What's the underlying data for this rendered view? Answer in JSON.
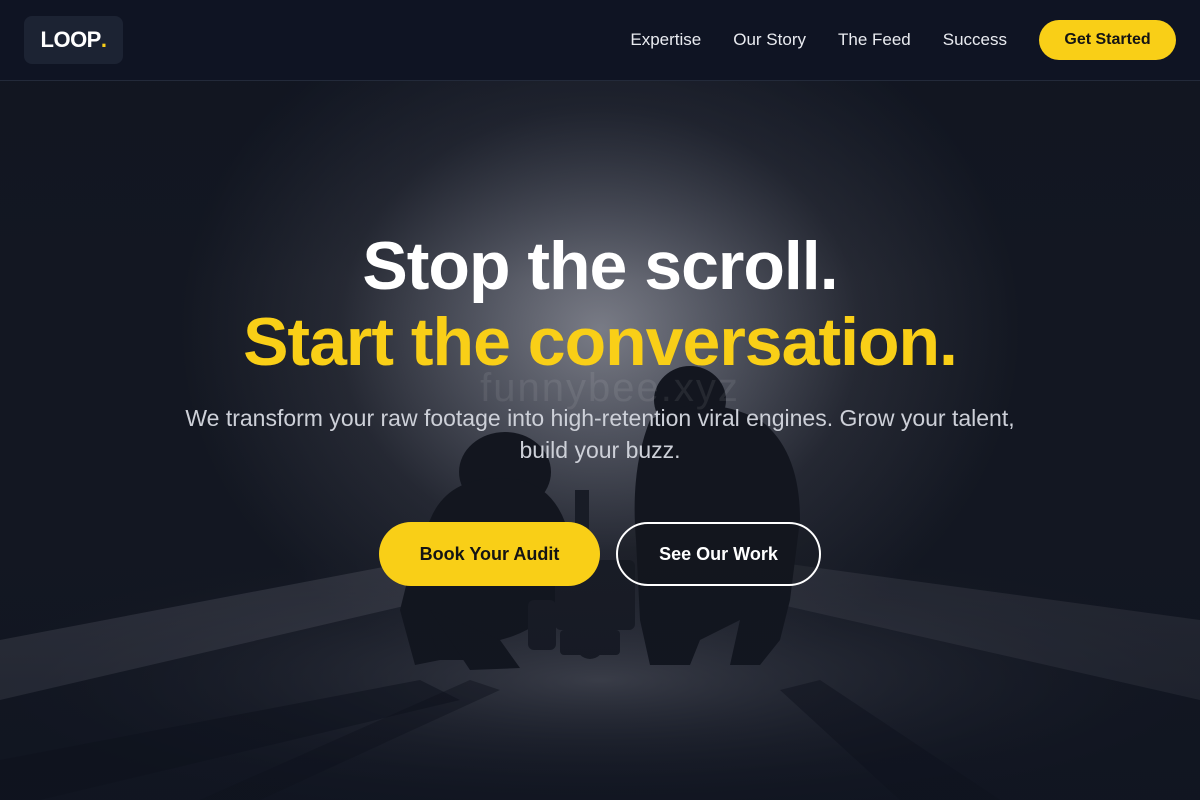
{
  "brand": {
    "name": "LOOP",
    "dot": ".",
    "accent_color": "#f9cf17"
  },
  "nav": {
    "links": [
      {
        "label": "Expertise"
      },
      {
        "label": "Our Story"
      },
      {
        "label": "The Feed"
      },
      {
        "label": "Success"
      }
    ],
    "cta_label": "Get Started"
  },
  "hero": {
    "headline_line1": "Stop the scroll.",
    "headline_line2": "Start the conversation.",
    "subtext": "We transform your raw footage into high-retention viral engines. Grow your talent, build your buzz.",
    "primary_cta": "Book Your Audit",
    "secondary_cta": "See Our Work",
    "watermark": "funnybee.xyz",
    "background_image": "film-crew-silhouette-scene"
  },
  "colors": {
    "background": "#0f1420",
    "navbar": "#0f1423",
    "accent": "#f9cf17",
    "text_primary": "#ffffff",
    "text_muted": "#cdd0d8"
  }
}
